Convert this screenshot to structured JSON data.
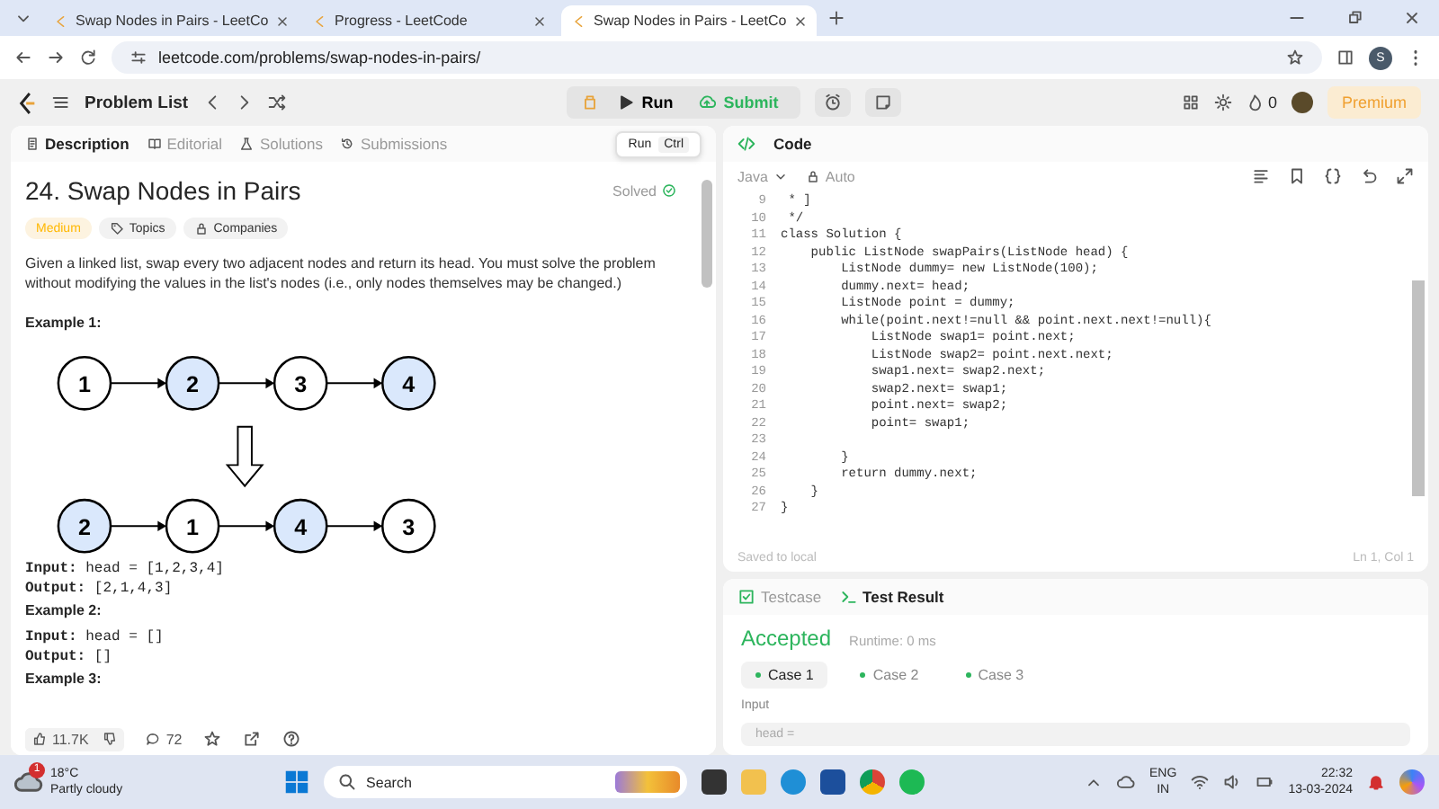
{
  "browser": {
    "tabs": [
      {
        "title": "Swap Nodes in Pairs - LeetCo",
        "selected": false
      },
      {
        "title": "Progress - LeetCode",
        "selected": false
      },
      {
        "title": "Swap Nodes in Pairs - LeetCo",
        "selected": true
      }
    ],
    "url": "leetcode.com/problems/swap-nodes-in-pairs/",
    "profile_initial": "S"
  },
  "nav": {
    "problem_list": "Problem List",
    "run": "Run",
    "submit": "Submit",
    "streak": "0",
    "premium": "Premium"
  },
  "left": {
    "tabs": [
      {
        "label": "Description",
        "selected": true
      },
      {
        "label": "Editorial",
        "selected": false
      },
      {
        "label": "Solutions",
        "selected": false
      },
      {
        "label": "Submissions",
        "selected": false
      }
    ],
    "run_hint": {
      "label": "Run",
      "key": "Ctrl"
    },
    "title": "24. Swap Nodes in Pairs",
    "status": "Solved",
    "difficulty": "Medium",
    "tags": [
      "Topics",
      "Companies"
    ],
    "description": "Given a linked list, swap every two adjacent nodes and return its head. You must solve the problem without modifying the values in the list's nodes (i.e., only nodes themselves may be changed.)",
    "example_1": "Example 1:",
    "diagram": [
      [
        {
          "label": "1",
          "highlighted": false
        },
        {
          "label": "2",
          "highlighted": true
        },
        {
          "label": "3",
          "highlighted": false
        },
        {
          "label": "4",
          "highlighted": true
        }
      ],
      [
        {
          "label": "2",
          "highlighted": true
        },
        {
          "label": "1",
          "highlighted": false
        },
        {
          "label": "4",
          "highlighted": true
        },
        {
          "label": "3",
          "highlighted": false
        }
      ]
    ],
    "example_1_io": [
      "**Input:** head = [1,2,3,4]",
      "**Output:** [2,1,4,3]"
    ],
    "example_2": "Example 2:",
    "example_2_io": [
      "**Input:** head = []",
      "**Output:** []"
    ],
    "example_3": "Example 3:",
    "likes": "11.7K",
    "comments": "72"
  },
  "code": {
    "title": "Code",
    "language": "Java",
    "mode": "Auto",
    "lines": [
      {
        "n": "9",
        "text": " * ]"
      },
      {
        "n": "10",
        "text": " */"
      },
      {
        "n": "11",
        "text": "class Solution {"
      },
      {
        "n": "12",
        "text": "    public ListNode swapPairs(ListNode head) {"
      },
      {
        "n": "13",
        "text": "        ListNode dummy= new ListNode(100);"
      },
      {
        "n": "14",
        "text": "        dummy.next= head;"
      },
      {
        "n": "15",
        "text": "        ListNode point = dummy;"
      },
      {
        "n": "16",
        "text": "        while(point.next!=null && point.next.next!=null){"
      },
      {
        "n": "17",
        "text": "            ListNode swap1= point.next;"
      },
      {
        "n": "18",
        "text": "            ListNode swap2= point.next.next;"
      },
      {
        "n": "19",
        "text": "            swap1.next= swap2.next;"
      },
      {
        "n": "20",
        "text": "            swap2.next= swap1;"
      },
      {
        "n": "21",
        "text": "            point.next= swap2;"
      },
      {
        "n": "22",
        "text": "            point= swap1;"
      },
      {
        "n": "23"
      },
      {
        "n": "24",
        "text": "        }"
      },
      {
        "n": "25",
        "text": "        return dummy.next;"
      },
      {
        "n": "26",
        "text": "    }"
      },
      {
        "n": "27",
        "text": "}"
      }
    ],
    "saved": "Saved to local",
    "cursor": "Ln 1, Col 1"
  },
  "test": {
    "tabs": [
      {
        "label": "Testcase",
        "selected": false
      },
      {
        "label": "Test Result",
        "selected": true
      }
    ],
    "verdict": "Accepted",
    "runtime": "Runtime: 0 ms",
    "cases": [
      {
        "label": "Case 1",
        "selected": true
      },
      {
        "label": "Case 2",
        "selected": false
      },
      {
        "label": "Case 3",
        "selected": false
      }
    ],
    "input_label": "Input",
    "input_value": "head ="
  },
  "taskbar": {
    "temperature": "18°C",
    "weather": "Partly cloudy",
    "alert_count": "1",
    "search": "Search",
    "language": "ENG",
    "region": "IN",
    "time": "22:32",
    "date": "13-03-2024"
  }
}
